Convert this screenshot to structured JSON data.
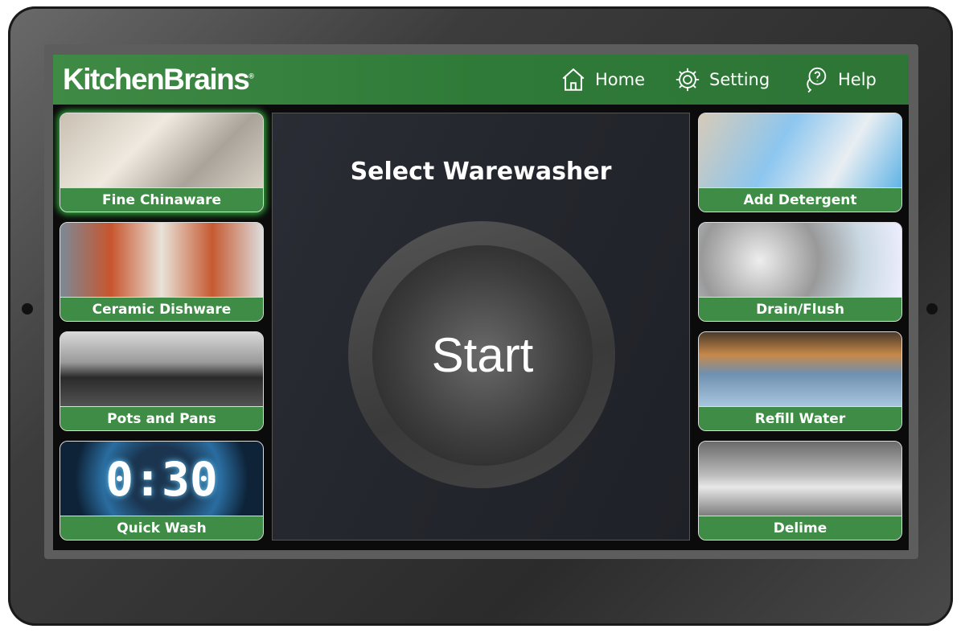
{
  "brand": {
    "name": "KitchenBrains",
    "mark": "®"
  },
  "nav": [
    {
      "label": "Home",
      "icon": "home-icon"
    },
    {
      "label": "Setting",
      "icon": "gear-icon"
    },
    {
      "label": "Help",
      "icon": "help-chat-icon"
    }
  ],
  "left_tiles": [
    {
      "label": "Fine Chinaware",
      "selected": true
    },
    {
      "label": "Ceramic Dishware",
      "selected": false
    },
    {
      "label": "Pots and Pans",
      "selected": false
    },
    {
      "label": "Quick Wash",
      "selected": false,
      "timer": "0:30"
    }
  ],
  "right_tiles": [
    {
      "label": "Add Detergent"
    },
    {
      "label": "Drain/Flush"
    },
    {
      "label": "Refill Water"
    },
    {
      "label": "Delime"
    }
  ],
  "main": {
    "title": "Select Warewasher",
    "start_label": "Start"
  },
  "colors": {
    "header_green": "#2f7a38",
    "label_green": "#3e8c45",
    "selected_glow": "#2fa03a"
  }
}
